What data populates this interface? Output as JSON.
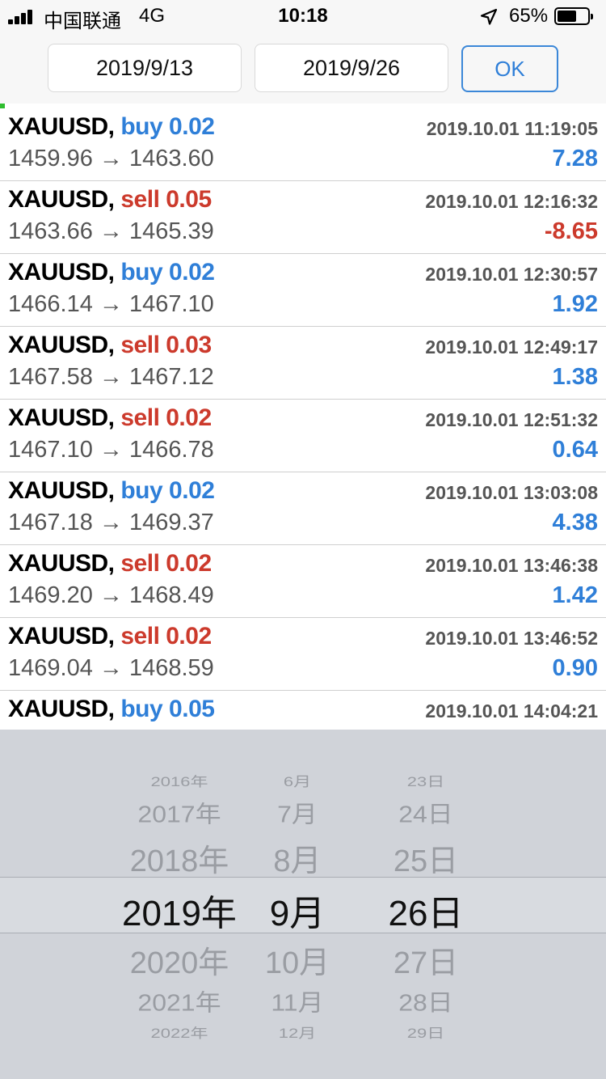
{
  "status_bar": {
    "carrier": "中国联通",
    "network": "4G",
    "time": "10:18",
    "battery_percent": "65%",
    "battery_level": 0.65,
    "icons": [
      "signal-icon",
      "location-arrow-icon",
      "battery-icon"
    ]
  },
  "date_filter": {
    "from": "2019/9/13",
    "to": "2019/9/26",
    "ok_label": "OK"
  },
  "colors": {
    "buy": "#2f7fd8",
    "sell": "#cc3a2c",
    "profit_positive": "#2f7fd8",
    "profit_negative": "#cc3a2c"
  },
  "trades": [
    {
      "symbol": "XAUUSD,",
      "side": "buy",
      "lots": "0.02",
      "time": "2019.10.01 11:19:05",
      "open": "1459.96",
      "arrow": "→",
      "close": "1463.60",
      "profit": "7.28"
    },
    {
      "symbol": "XAUUSD,",
      "side": "sell",
      "lots": "0.05",
      "time": "2019.10.01 12:16:32",
      "open": "1463.66",
      "arrow": "→",
      "close": "1465.39",
      "profit": "-8.65"
    },
    {
      "symbol": "XAUUSD,",
      "side": "buy",
      "lots": "0.02",
      "time": "2019.10.01 12:30:57",
      "open": "1466.14",
      "arrow": "→",
      "close": "1467.10",
      "profit": "1.92"
    },
    {
      "symbol": "XAUUSD,",
      "side": "sell",
      "lots": "0.03",
      "time": "2019.10.01 12:49:17",
      "open": "1467.58",
      "arrow": "→",
      "close": "1467.12",
      "profit": "1.38"
    },
    {
      "symbol": "XAUUSD,",
      "side": "sell",
      "lots": "0.02",
      "time": "2019.10.01 12:51:32",
      "open": "1467.10",
      "arrow": "→",
      "close": "1466.78",
      "profit": "0.64"
    },
    {
      "symbol": "XAUUSD,",
      "side": "buy",
      "lots": "0.02",
      "time": "2019.10.01 13:03:08",
      "open": "1467.18",
      "arrow": "→",
      "close": "1469.37",
      "profit": "4.38"
    },
    {
      "symbol": "XAUUSD,",
      "side": "sell",
      "lots": "0.02",
      "time": "2019.10.01 13:46:38",
      "open": "1469.20",
      "arrow": "→",
      "close": "1468.49",
      "profit": "1.42"
    },
    {
      "symbol": "XAUUSD,",
      "side": "sell",
      "lots": "0.02",
      "time": "2019.10.01 13:46:52",
      "open": "1469.04",
      "arrow": "→",
      "close": "1468.59",
      "profit": "0.90"
    },
    {
      "symbol": "XAUUSD,",
      "side": "buy",
      "lots": "0.05",
      "time": "2019.10.01 14:04:21",
      "open": "",
      "arrow": "",
      "close": "",
      "profit": ""
    }
  ],
  "date_picker": {
    "selected_index": 3,
    "years": [
      "2016年",
      "2017年",
      "2018年",
      "2019年",
      "2020年",
      "2021年",
      "2022年"
    ],
    "months": [
      "6月",
      "7月",
      "8月",
      "9月",
      "10月",
      "11月",
      "12月"
    ],
    "days": [
      "23日",
      "24日",
      "25日",
      "26日",
      "27日",
      "28日",
      "29日"
    ]
  }
}
